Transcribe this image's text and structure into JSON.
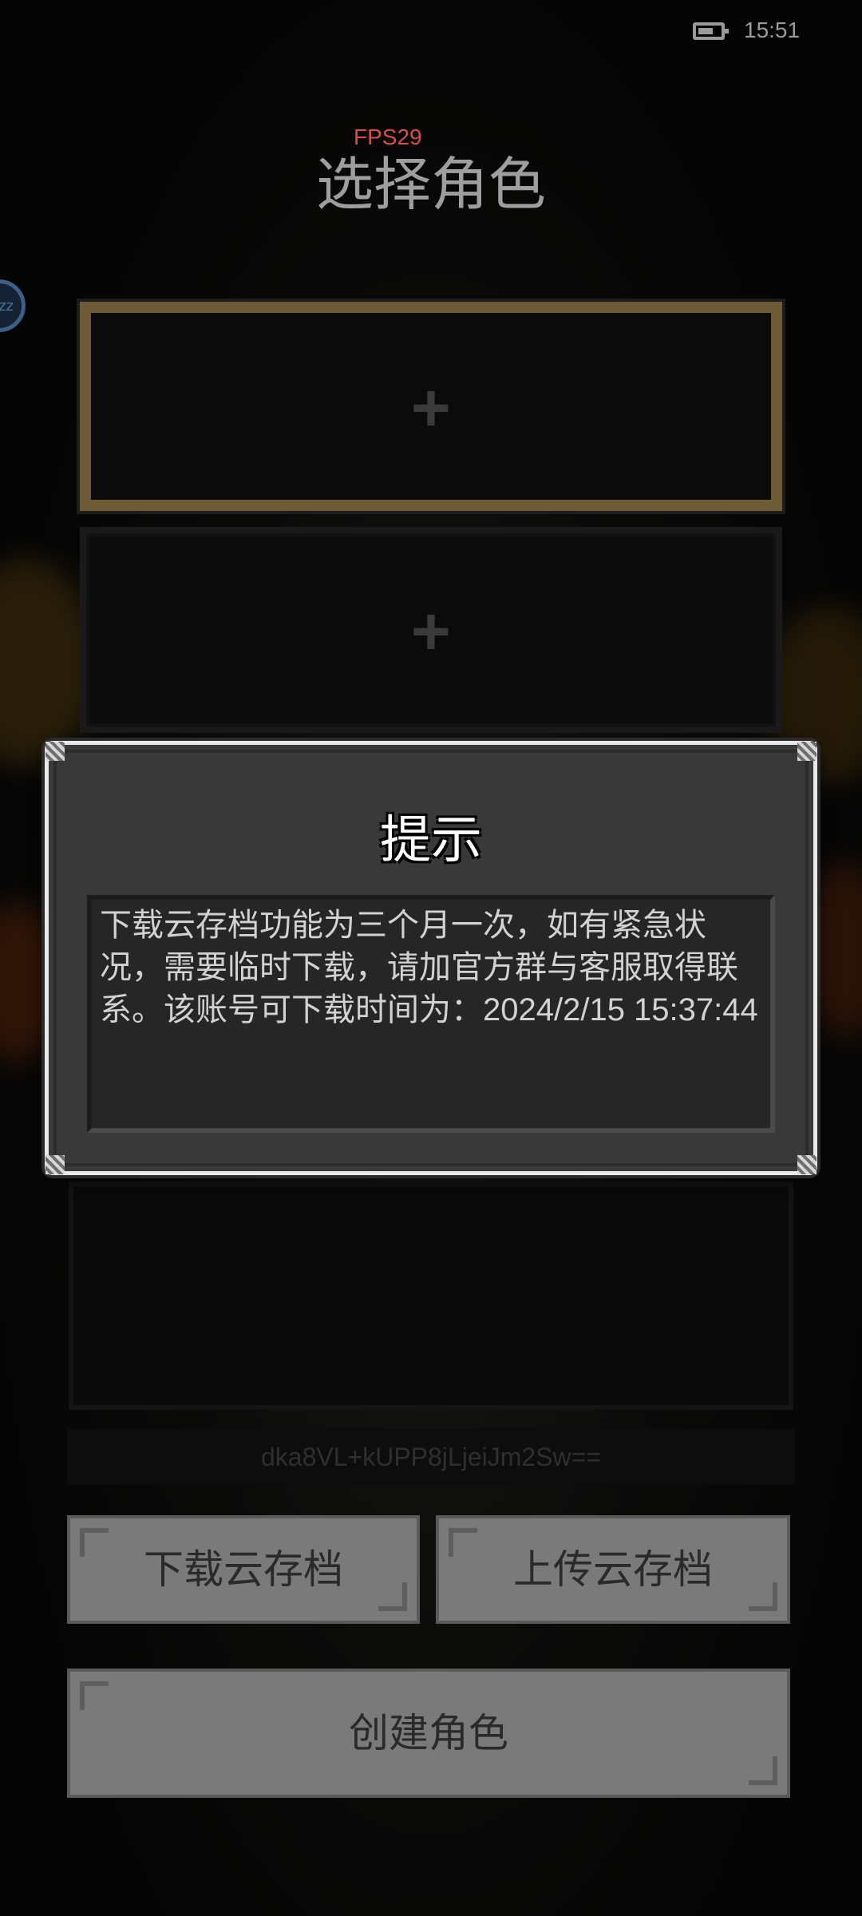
{
  "status_bar": {
    "time": "15:51",
    "battery_icon": "battery-icon"
  },
  "overlay": {
    "fps": "FPS29"
  },
  "header": {
    "title": "选择角色"
  },
  "slots": [
    {
      "icon": "+",
      "selected": true
    },
    {
      "icon": "+",
      "selected": false
    }
  ],
  "account": {
    "id": "dka8VL+kUPP8jLjeiJm2Sw=="
  },
  "buttons": {
    "download": "下载云存档",
    "upload": "上传云存档",
    "create": "创建角色"
  },
  "dialog": {
    "title": "提示",
    "message": "下载云存档功能为三个月一次，如有紧急状况，需要临时下载，请加官方群与客服取得联系。该账号可下载时间为：2024/2/15 15:37:44"
  },
  "colors": {
    "selected_slot_border": "#6c5b35",
    "fps_text": "#d64f4f",
    "button_bg": "#7a7a7a",
    "dialog_bg": "#3a3a3a"
  }
}
